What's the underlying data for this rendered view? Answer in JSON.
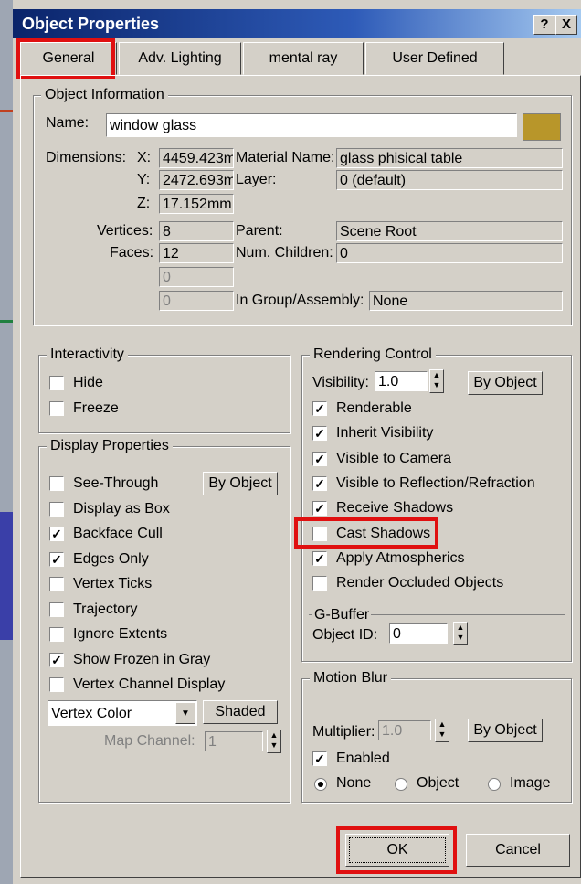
{
  "window": {
    "title": "Object Properties",
    "help_label": "?",
    "close_label": "X"
  },
  "tabs": [
    "General",
    "Adv. Lighting",
    "mental ray",
    "User Defined"
  ],
  "object_info": {
    "group_label": "Object Information",
    "name_label": "Name:",
    "name_value": "window glass",
    "color_swatch": "#b8962a",
    "dimensions_label": "Dimensions:",
    "x_label": "X:",
    "x_value": "4459.423m",
    "y_label": "Y:",
    "y_value": "2472.693m",
    "z_label": "Z:",
    "z_value": "17.152mm",
    "material_label": "Material Name:",
    "material_value": "glass phisical table",
    "layer_label": "Layer:",
    "layer_value": "0 (default)",
    "vertices_label": "Vertices:",
    "vertices_value": "8",
    "faces_label": "Faces:",
    "faces_value": "12",
    "extra1_value": "0",
    "extra2_value": "0",
    "parent_label": "Parent:",
    "parent_value": "Scene Root",
    "children_label": "Num. Children:",
    "children_value": "0",
    "group_assembly_label": "In Group/Assembly:",
    "group_assembly_value": "None"
  },
  "interactivity": {
    "group_label": "Interactivity",
    "items": [
      {
        "label": "Hide",
        "checked": false
      },
      {
        "label": "Freeze",
        "checked": false
      }
    ]
  },
  "display_properties": {
    "group_label": "Display Properties",
    "by_object_label": "By Object",
    "items": [
      {
        "label": "See-Through",
        "checked": false
      },
      {
        "label": "Display as Box",
        "checked": false
      },
      {
        "label": "Backface Cull",
        "checked": true
      },
      {
        "label": "Edges Only",
        "checked": true
      },
      {
        "label": "Vertex Ticks",
        "checked": false
      },
      {
        "label": "Trajectory",
        "checked": false
      },
      {
        "label": "Ignore Extents",
        "checked": false
      },
      {
        "label": "Show Frozen in Gray",
        "checked": true
      },
      {
        "label": "Vertex Channel Display",
        "checked": false
      }
    ],
    "vertex_select_value": "Vertex Color",
    "shaded_label": "Shaded",
    "map_channel_label": "Map Channel:",
    "map_channel_value": "1"
  },
  "rendering_control": {
    "group_label": "Rendering Control",
    "visibility_label": "Visibility:",
    "visibility_value": "1.0",
    "by_object_label": "By Object",
    "items": [
      {
        "label": "Renderable",
        "checked": true
      },
      {
        "label": "Inherit Visibility",
        "checked": true
      },
      {
        "label": "Visible to Camera",
        "checked": true
      },
      {
        "label": "Visible to Reflection/Refraction",
        "checked": true
      },
      {
        "label": "Receive Shadows",
        "checked": true
      },
      {
        "label": "Cast Shadows",
        "checked": false
      },
      {
        "label": "Apply Atmospherics",
        "checked": true
      },
      {
        "label": "Render Occluded Objects",
        "checked": false
      }
    ],
    "gbuffer_label": "G-Buffer",
    "object_id_label": "Object ID:",
    "object_id_value": "0"
  },
  "motion_blur": {
    "group_label": "Motion Blur",
    "multiplier_label": "Multiplier:",
    "multiplier_value": "1.0",
    "by_object_label": "By Object",
    "enabled_label": "Enabled",
    "enabled_checked": true,
    "options": [
      {
        "label": "None",
        "selected": true
      },
      {
        "label": "Object",
        "selected": false
      },
      {
        "label": "Image",
        "selected": false
      }
    ]
  },
  "footer": {
    "ok_label": "OK",
    "cancel_label": "Cancel"
  },
  "highlight_color": "#e01010"
}
